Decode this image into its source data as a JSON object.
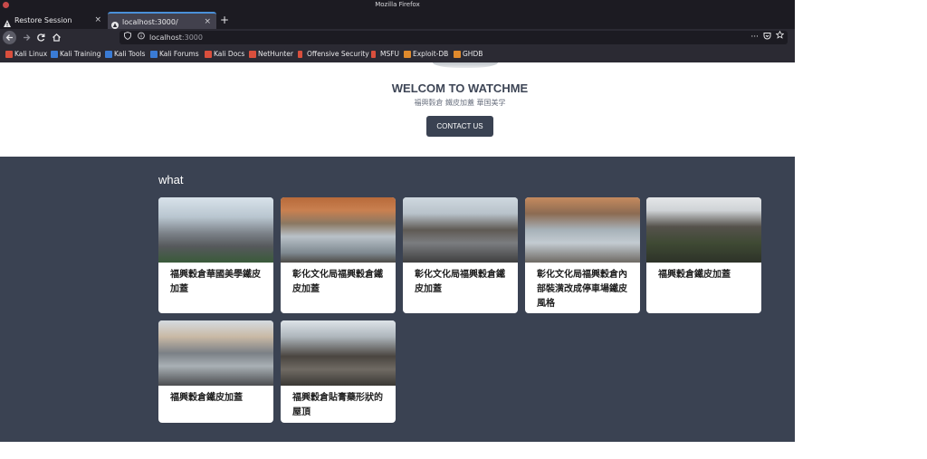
{
  "window": {
    "title": "Mozilla Firefox"
  },
  "tabs": [
    {
      "label": "Restore Session",
      "close": "×"
    },
    {
      "label": "localhost:3000/",
      "close": "×"
    }
  ],
  "new_tab": "+",
  "nav": {
    "url_host": "localhost",
    "url_port": ":3000",
    "page_actions": "···"
  },
  "bookmarks": [
    {
      "label": "Kali Linux",
      "color": "#d94f3d"
    },
    {
      "label": "Kali Training",
      "color": "#3a7bd5"
    },
    {
      "label": "Kali Tools",
      "color": "#3a7bd5"
    },
    {
      "label": "Kali Forums",
      "color": "#3a7bd5"
    },
    {
      "label": "Kali Docs",
      "color": "#d94f3d"
    },
    {
      "label": "NetHunter",
      "color": "#d94f3d"
    },
    {
      "label": "Offensive Security",
      "color": "#d94f3d"
    },
    {
      "label": "MSFU",
      "color": "#d94f3d"
    },
    {
      "label": "Exploit-DB",
      "color": "#e08a2c"
    },
    {
      "label": "GHDB",
      "color": "#e08a2c"
    }
  ],
  "page": {
    "title": "WELCOM TO WATCHME",
    "subtitle": "福興穀倉 鐵皮加蓋 華国美学",
    "contact_button": "CONTACT US",
    "section_title": "what",
    "cards": [
      {
        "title": "福興穀倉華國美學鐵皮加蓋"
      },
      {
        "title": "彰化文化局福興穀倉鐵皮加蓋"
      },
      {
        "title": "彰化文化局福興穀倉鐵皮加蓋"
      },
      {
        "title": "彰化文化局福興穀倉內部裝潢改成停車場鐵皮風格"
      },
      {
        "title": "福興穀倉鐵皮加蓋"
      },
      {
        "title": "福興穀倉鐵皮加蓋"
      },
      {
        "title": "福興穀倉貼膏藥形狀的屋頂"
      }
    ]
  },
  "colors": {
    "chrome_dark": "#1c1b22",
    "chrome_mid": "#2b2a33",
    "accent_tab": "#4a90d9",
    "section_bg": "#3a4252",
    "button_bg": "#3a4252"
  }
}
